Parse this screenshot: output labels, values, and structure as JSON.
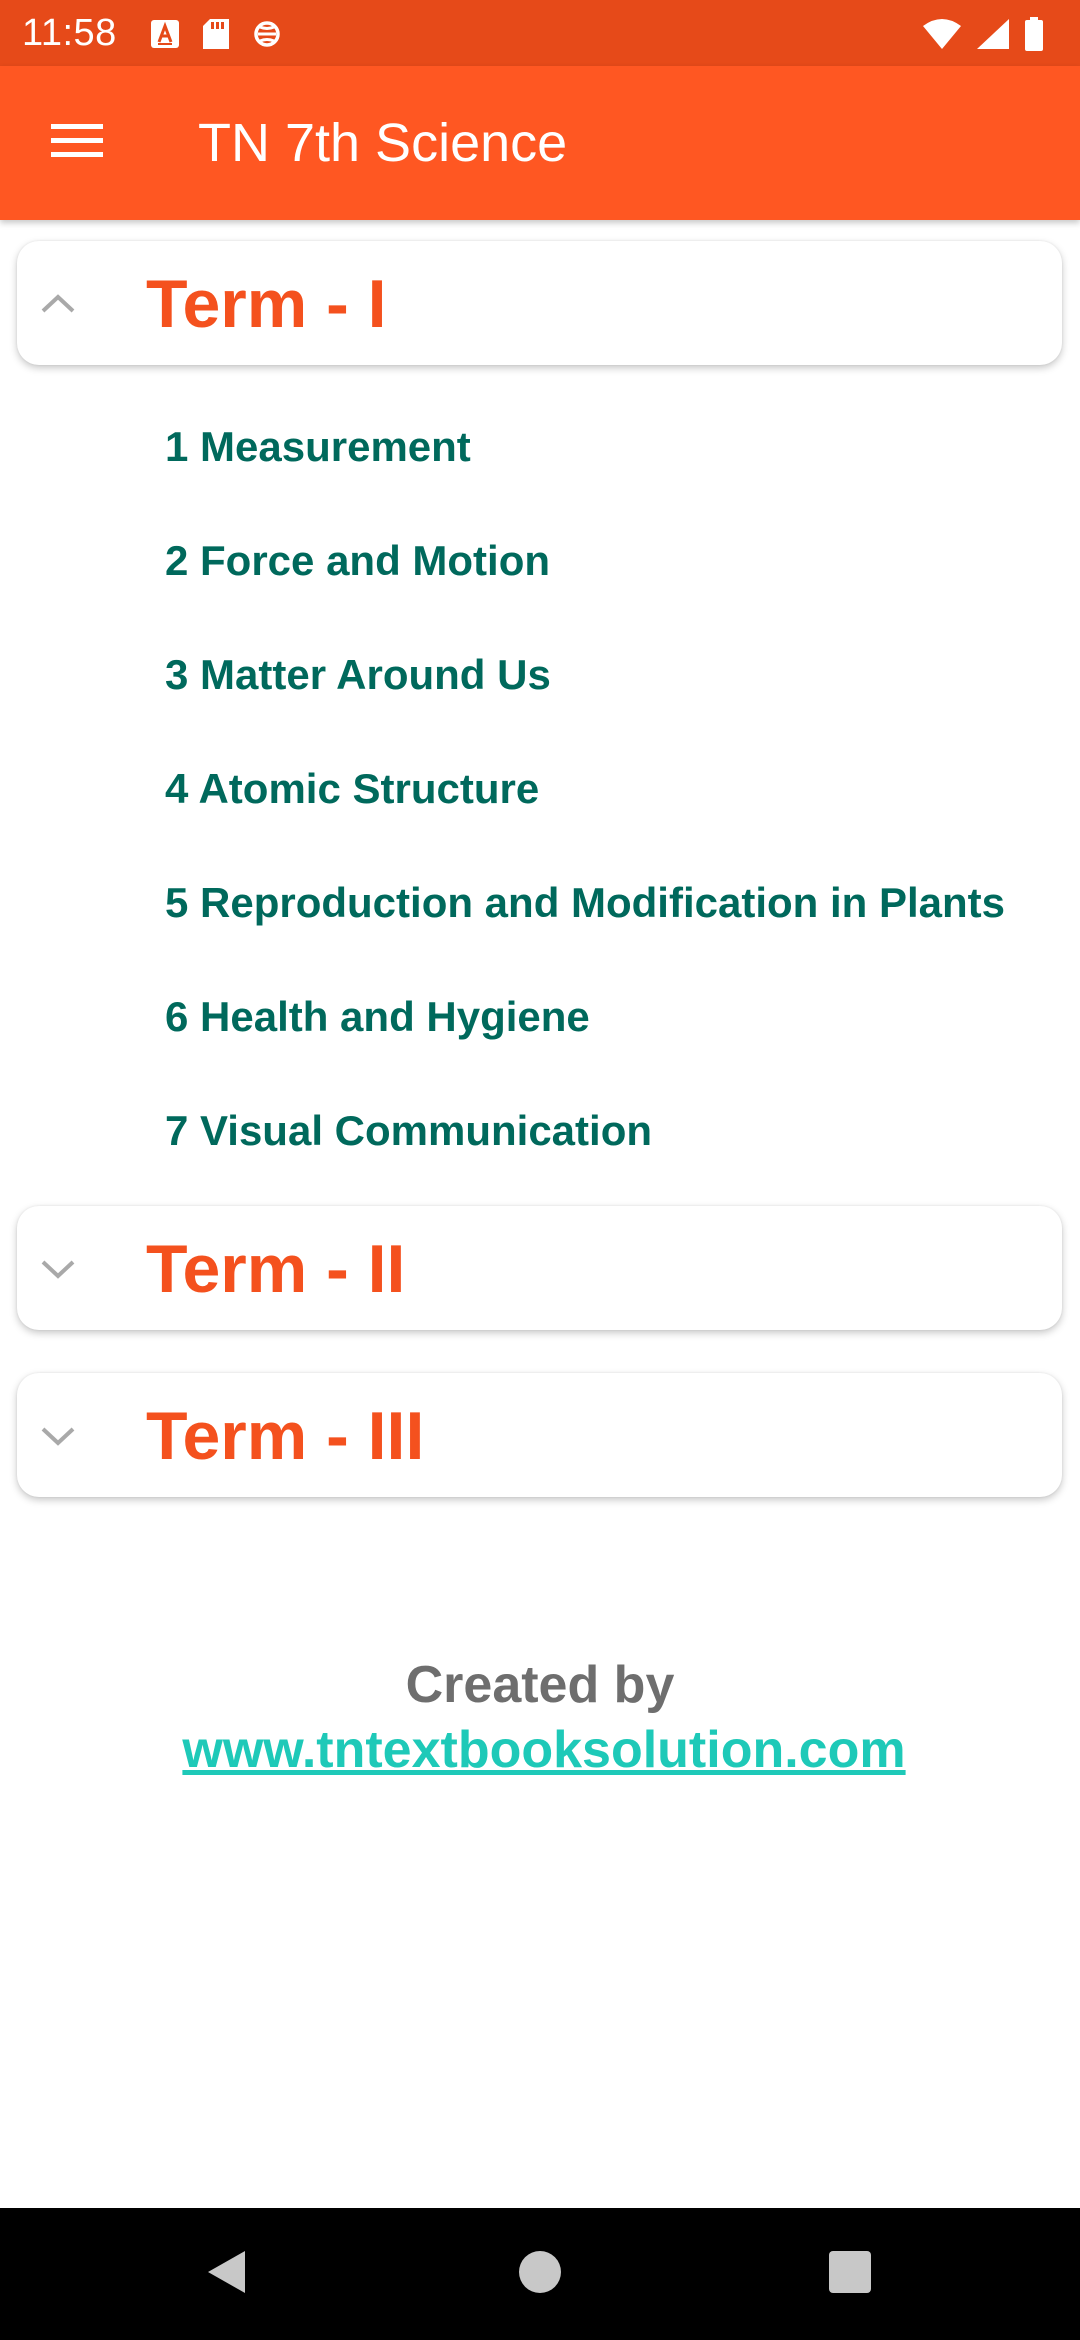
{
  "status_bar": {
    "time": "11:58",
    "color": "#e64a19",
    "left_icons": [
      "text-a-icon",
      "sd-card-icon",
      "sync-shield-icon"
    ],
    "right_icons": [
      "wifi-icon",
      "cellular-signal-icon",
      "battery-icon"
    ]
  },
  "app_bar": {
    "title": "TN 7th Science",
    "color": "#ff5722",
    "menu_icon": "hamburger-menu-icon"
  },
  "terms": [
    {
      "label": "Term - I",
      "expanded": true,
      "chapters": [
        "1 Measurement",
        "2 Force and Motion",
        "3 Matter Around Us",
        "4 Atomic Structure",
        "5 Reproduction and Modification in Plants",
        "6 Health and Hygiene",
        "7 Visual Communication"
      ]
    },
    {
      "label": "Term - II",
      "expanded": false
    },
    {
      "label": "Term - III",
      "expanded": false
    }
  ],
  "colors": {
    "term_title": "#f4511e",
    "chapter_text": "#00695c",
    "footer_text": "#6e6e6e",
    "footer_link": "#1ec9b8"
  },
  "footer": {
    "created_by": "Created by",
    "link": "www.tntextbooksolution.com"
  },
  "nav_bar": {
    "buttons": [
      "back-icon",
      "home-icon",
      "recents-icon"
    ]
  }
}
